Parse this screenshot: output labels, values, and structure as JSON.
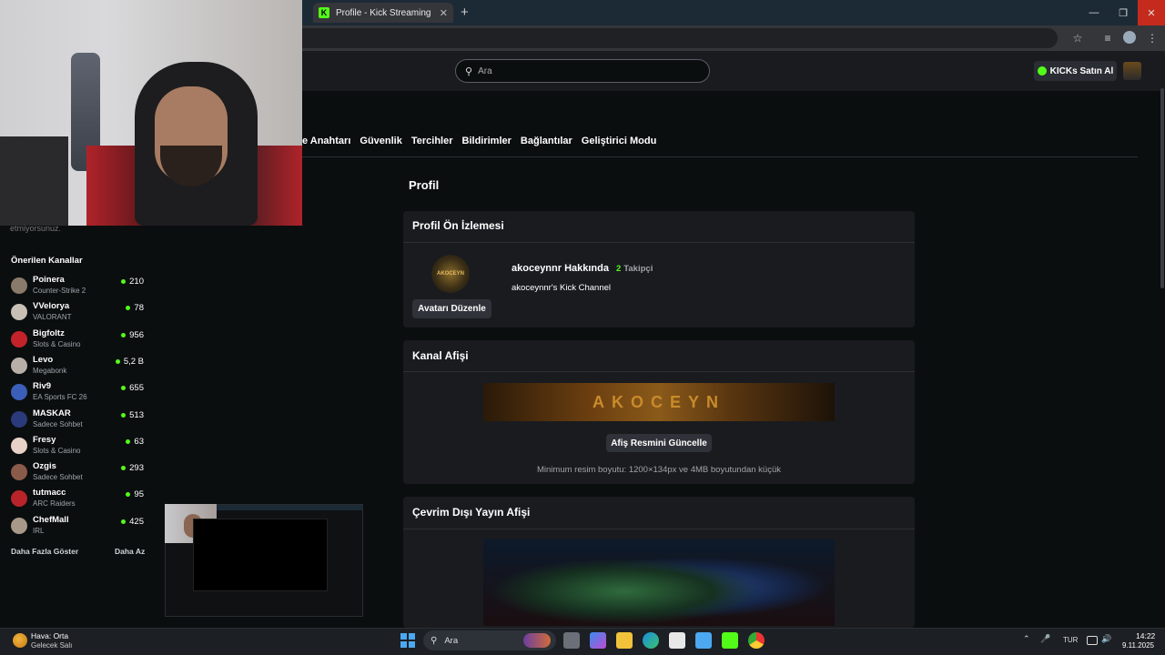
{
  "browser": {
    "tab_title": "Profile - Kick Streaming",
    "tab_close": "✕",
    "new_tab": "+",
    "favicon_letter": "K",
    "window_controls": {
      "minimize": "—",
      "restore": "❐",
      "close": "✕"
    },
    "icons": {
      "bookmark": "☆",
      "media": "≡",
      "menu": "⋮"
    }
  },
  "header": {
    "search_placeholder": "Ara",
    "search_icon": "⚲",
    "kicks_button": "KICKs Satın Al"
  },
  "settings_nav": {
    "items": [
      "e Anahtarı",
      "Güvenlik",
      "Tercihler",
      "Bildirimler",
      "Bağlantılar",
      "Geliştirici Modu"
    ]
  },
  "page": {
    "title": "Profil",
    "preview_card": {
      "heading": "Profil Ön İzlemesi",
      "avatar_text": "AKOCEYN",
      "about": "akoceynnr Hakkında",
      "follower_count": "2",
      "follower_label": "Takipçi",
      "channel_desc": "akoceynnr's Kick Channel",
      "edit_avatar": "Avatarı Düzenle"
    },
    "banner_card": {
      "heading": "Kanal Afişi",
      "banner_text": "AKOCEYN",
      "update_button": "Afiş Resmini Güncelle",
      "hint": "Minimum resim boyutu: 1200×134px ve 4MB boyutundan küçük"
    },
    "offline_card": {
      "heading": "Çevrim Dışı Yayın Afişi"
    }
  },
  "overlay": {
    "ghost_text": "etmiyorsunuz.",
    "recommended_title": "Önerilen Kanallar",
    "channels": [
      {
        "name": "Poinera",
        "category": "Counter-Strike 2",
        "viewers": "210",
        "color": "#8a7a6a"
      },
      {
        "name": "VVelorya",
        "category": "VALORANT",
        "viewers": "78",
        "color": "#c9c0b5"
      },
      {
        "name": "Bigfoltz",
        "category": "Slots & Casino",
        "viewers": "956",
        "color": "#c4222a"
      },
      {
        "name": "Levo",
        "category": "Megabonk",
        "viewers": "5,2 B",
        "color": "#b8b0a8"
      },
      {
        "name": "Riv9",
        "category": "EA Sports FC 26",
        "viewers": "655",
        "color": "#3b5fb8"
      },
      {
        "name": "MASKAR",
        "category": "Sadece Sohbet",
        "viewers": "513",
        "color": "#2a3a7a"
      },
      {
        "name": "Fresy",
        "category": "Slots & Casino",
        "viewers": "63",
        "color": "#e8d2c8"
      },
      {
        "name": "Ozgis",
        "category": "Sadece Sohbet",
        "viewers": "293",
        "color": "#8a5a4a"
      },
      {
        "name": "tutmacc",
        "category": "ARC Raiders",
        "viewers": "95",
        "color": "#b8242a"
      },
      {
        "name": "ChefMall",
        "category": "IRL",
        "viewers": "425",
        "color": "#a89888"
      }
    ],
    "show_more": "Daha Fazla Göster",
    "show_less": "Daha Az"
  },
  "taskbar": {
    "weather_title": "Hava: Orta",
    "weather_sub": "Gelecek Salı",
    "search_placeholder": "Ara",
    "search_icon": "⚲",
    "tray_up": "⌃",
    "mic": "🎤",
    "lang": "TUR",
    "volume": "🔊",
    "time": "14:22",
    "date": "9.11.2025"
  },
  "colors": {
    "accent": "#53fc18",
    "background": "#0b0e0f",
    "card": "#191b1f"
  }
}
